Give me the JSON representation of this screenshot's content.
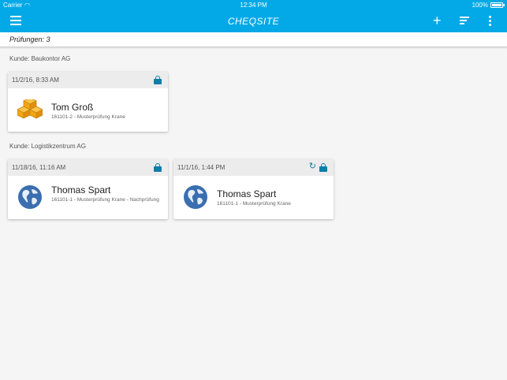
{
  "status_bar": {
    "carrier": "Carrier",
    "time": "12:34 PM",
    "battery": "100%"
  },
  "app_bar": {
    "title": "CHEQSITE",
    "add_icon": "plus-icon",
    "sort_icon": "sort-icon",
    "more_icon": "more-vert-icon",
    "menu_icon": "menu-icon"
  },
  "count_bar": {
    "label": "Prüfungen: 3"
  },
  "accent": "#03a9e6",
  "groups": [
    {
      "label": "Kunde: Baukontor AG",
      "cards": [
        {
          "date": "11/2/16, 8:33 AM",
          "name": "Tom Groß",
          "sub": "161101-2 - Musterprüfung Krane",
          "icon": "boxes-icon",
          "locked": true
        }
      ]
    },
    {
      "label": "Kunde: Logistikzentrum AG",
      "cards": [
        {
          "date": "11/18/16, 11:16 AM",
          "name": "Thomas Spart",
          "sub": "161101-1 - Musterprüfung Krane - Nachprüfung",
          "icon": "globe-icon",
          "locked": true
        },
        {
          "date": "11/1/16, 1:44 PM",
          "name": "Thomas Spart",
          "sub": "161101-1 - Musterprüfung Krane",
          "icon": "globe-icon",
          "locked": true,
          "refresh": true
        }
      ]
    }
  ]
}
